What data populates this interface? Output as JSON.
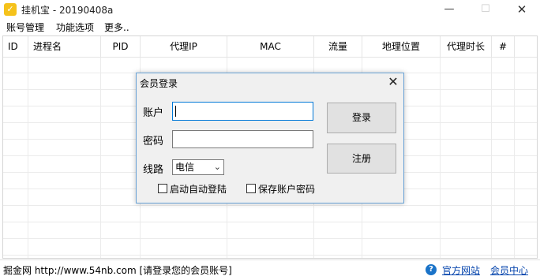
{
  "window": {
    "icon_glyph": "✓",
    "title": "挂机宝 - 20190408a",
    "min_glyph": "—",
    "max_glyph": "☐",
    "close_glyph": "✕"
  },
  "menu": {
    "items": [
      "账号管理",
      "功能选项",
      "更多.."
    ]
  },
  "table": {
    "columns": [
      "ID",
      "进程名",
      "PID",
      "代理IP",
      "MAC",
      "流量",
      "地理位置",
      "代理时长",
      "#"
    ]
  },
  "status": {
    "text": "掘金网 http://www.54nb.com [请登录您的会员账号]",
    "help_icon": "?",
    "link_official": "官方网站",
    "link_member": "会员中心"
  },
  "dialog": {
    "title": "会员登录",
    "close_glyph": "✕",
    "account_label": "账户",
    "account_value": "",
    "password_label": "密码",
    "password_value": "",
    "line_label": "线路",
    "line_selected": "电信",
    "line_chevron": "⌄",
    "auto_login_label": "启动自动登陆",
    "auto_login_checked": false,
    "save_password_label": "保存账户密码",
    "save_password_checked": false,
    "login_button": "登录",
    "register_button": "注册"
  },
  "colors": {
    "dialog_border": "#6aa3d6",
    "focus_border": "#0078d7",
    "link": "#0645ad",
    "help_icon": "#1a73c8",
    "app_icon": "#f5c21b"
  }
}
